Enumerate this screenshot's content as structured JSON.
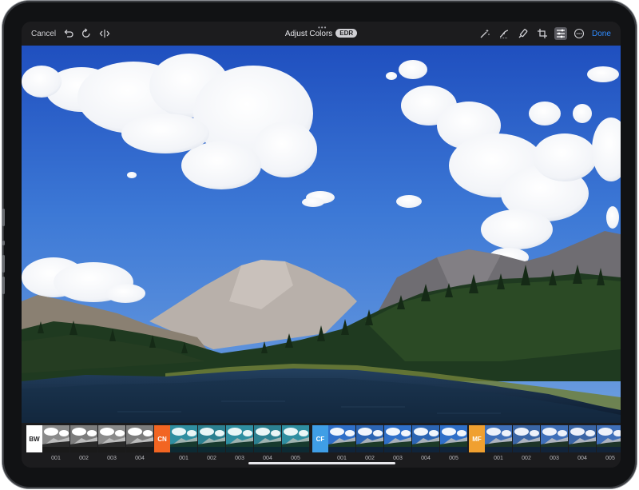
{
  "toolbar": {
    "cancel_label": "Cancel",
    "title": "Adjust Colors",
    "badge": "EDR",
    "done_label": "Done",
    "more_dots": "•••",
    "left_icons": [
      "undo-icon",
      "redo-icon",
      "compare-icon"
    ],
    "right_icons": [
      "auto-enhance-icon",
      "curves-icon",
      "brush-icon",
      "crop-icon",
      "sliders-icon",
      "more-icon"
    ]
  },
  "colors": {
    "accent": "#2f8cff",
    "bw": "#ffffff",
    "cn": "#f26522",
    "cf": "#3f9ee6",
    "mf": "#f0a030"
  },
  "filters": {
    "groups": [
      {
        "tag": "BW",
        "tag_color": "#ffffff",
        "tag_text_color": "#1c1c1e",
        "items": [
          "001",
          "002",
          "003",
          "004"
        ],
        "style": "mono"
      },
      {
        "tag": "CN",
        "tag_color": "#f26522",
        "tag_text_color": "#ffffff",
        "items": [
          "001",
          "002",
          "003",
          "004",
          "005"
        ],
        "style": "teal"
      },
      {
        "tag": "CF",
        "tag_color": "#3f9ee6",
        "tag_text_color": "#ffffff",
        "items": [
          "001",
          "002",
          "003",
          "004",
          "005"
        ],
        "style": "blue"
      },
      {
        "tag": "MF",
        "tag_color": "#f0a030",
        "tag_text_color": "#ffffff",
        "items": [
          "001",
          "002",
          "003",
          "004",
          "005"
        ],
        "style": "cool"
      }
    ]
  }
}
